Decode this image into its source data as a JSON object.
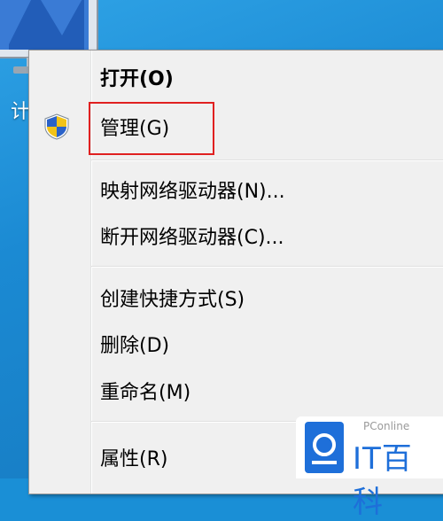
{
  "desktop": {
    "icon_name": "computer-icon",
    "icon_label": "计"
  },
  "context_menu": {
    "items": [
      {
        "label": "打开(O)",
        "bold": true,
        "icon": null
      },
      {
        "label": "管理(G)",
        "bold": false,
        "icon": "uac-shield-icon",
        "highlighted": true
      },
      {
        "label": "映射网络驱动器(N)...",
        "bold": false,
        "icon": null
      },
      {
        "label": "断开网络驱动器(C)...",
        "bold": false,
        "icon": null
      },
      {
        "label": "创建快捷方式(S)",
        "bold": false,
        "icon": null
      },
      {
        "label": "删除(D)",
        "bold": false,
        "icon": null
      },
      {
        "label": "重命名(M)",
        "bold": false,
        "icon": null
      },
      {
        "label": "属性(R)",
        "bold": false,
        "icon": null
      }
    ],
    "highlight_color": "#e02020"
  },
  "watermark": {
    "small_text": "PConline",
    "big_text": "IT百科",
    "brand_color": "#1e6fd9"
  }
}
